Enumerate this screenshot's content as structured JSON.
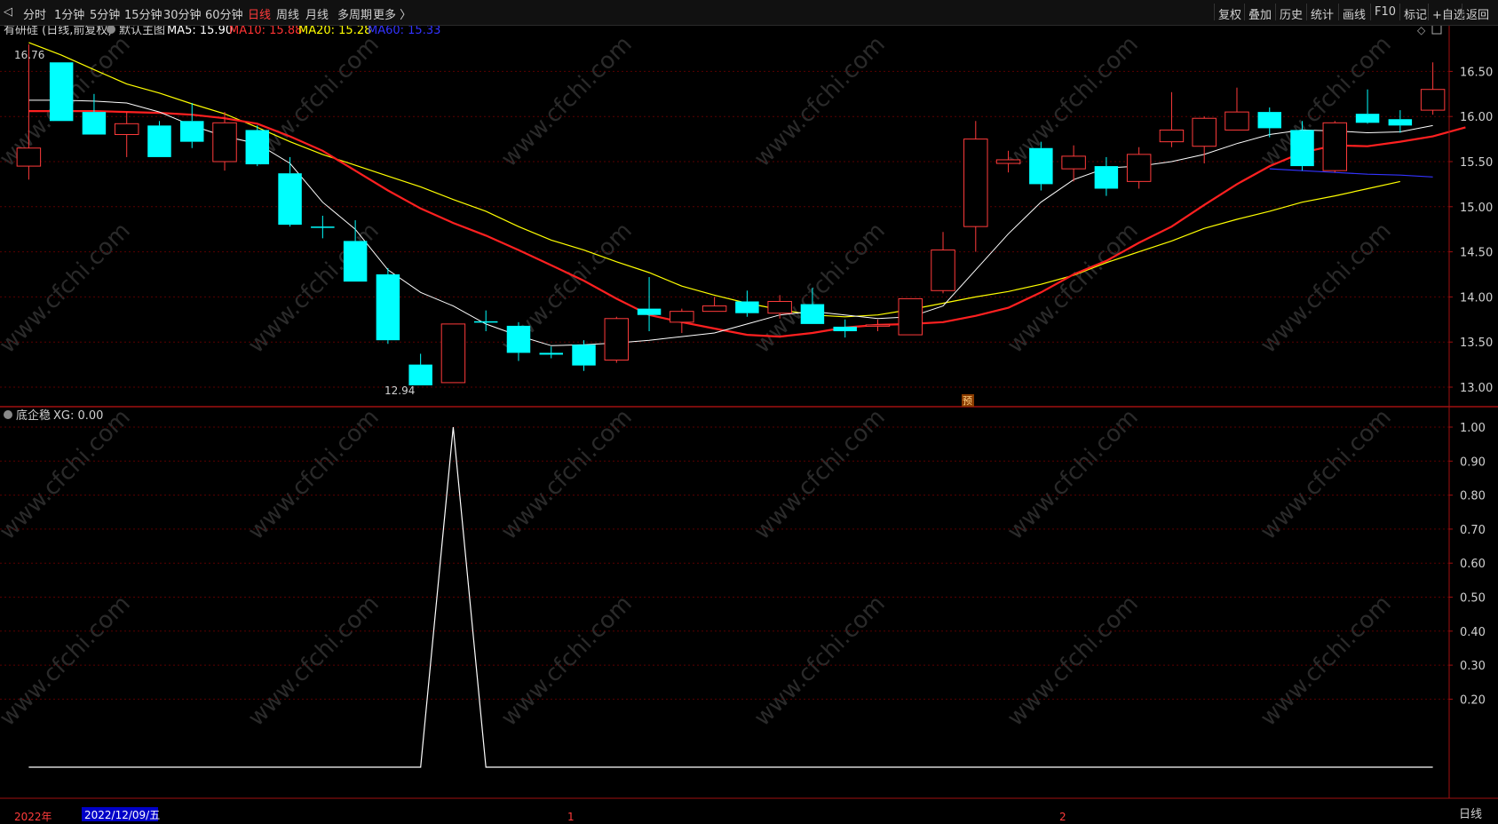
{
  "toolbar": {
    "left": [
      "分时",
      "1分钟",
      "5分钟",
      "15分钟",
      "30分钟",
      "60分钟",
      "日线",
      "周线",
      "月线",
      "多周期",
      "更多 〉"
    ],
    "active": "日线",
    "right": [
      "复权",
      "叠加",
      "历史",
      "统计",
      "画线",
      "F10",
      "标记",
      "+自选",
      "返回"
    ]
  },
  "main_legend": {
    "stock": "有研硅 (日线,前复权)",
    "template": "默认主图",
    "items": [
      {
        "label": "MA5: 15.90",
        "color": "#ffffff"
      },
      {
        "label": "MA10: 15.88",
        "color": "#ff3333"
      },
      {
        "label": "MA20: 15.28",
        "color": "#ffff00"
      },
      {
        "label": "MA60: 15.33",
        "color": "#3333ff"
      }
    ]
  },
  "sub_legend": {
    "name": "底企稳",
    "value": "XG: 0.00"
  },
  "annotations": {
    "high": "16.76",
    "low": "12.94",
    "forecast": "预"
  },
  "bottom": {
    "year": "2022年",
    "cursor_date": "2022/12/09/五",
    "month_labels": [
      "1",
      "2"
    ],
    "period": "日线"
  },
  "watermark": "www.cfchi.com",
  "colors": {
    "up": "#ff3b3b",
    "down": "#00ffff",
    "ma5": "#ffffff",
    "ma10": "#ff2020",
    "ma20": "#ffff00",
    "ma60": "#3333ff",
    "axis": "#a01010"
  },
  "chart_data": [
    {
      "type": "candlestick",
      "title": "有研硅 (日线,前复权)",
      "ylim": [
        12.8,
        16.8
      ],
      "y_ticks": [
        13.0,
        13.5,
        14.0,
        14.5,
        15.0,
        15.5,
        16.0,
        16.5
      ],
      "candles": [
        {
          "o": 15.45,
          "h": 16.8,
          "l": 15.3,
          "c": 15.65
        },
        {
          "o": 16.6,
          "h": 16.6,
          "l": 15.95,
          "c": 15.95
        },
        {
          "o": 16.05,
          "h": 16.25,
          "l": 15.8,
          "c": 15.8
        },
        {
          "o": 15.8,
          "h": 16.05,
          "l": 15.55,
          "c": 15.92
        },
        {
          "o": 15.9,
          "h": 15.95,
          "l": 15.55,
          "c": 15.55
        },
        {
          "o": 15.95,
          "h": 16.15,
          "l": 15.65,
          "c": 15.72
        },
        {
          "o": 15.5,
          "h": 16.05,
          "l": 15.4,
          "c": 15.93
        },
        {
          "o": 15.85,
          "h": 15.9,
          "l": 15.45,
          "c": 15.47
        },
        {
          "o": 15.37,
          "h": 15.55,
          "l": 14.78,
          "c": 14.8
        },
        {
          "o": 14.78,
          "h": 14.9,
          "l": 14.65,
          "c": 14.77
        },
        {
          "o": 14.62,
          "h": 14.85,
          "l": 14.17,
          "c": 14.17
        },
        {
          "o": 14.25,
          "h": 14.32,
          "l": 13.48,
          "c": 13.52
        },
        {
          "o": 13.25,
          "h": 13.37,
          "l": 13.02,
          "c": 13.02
        },
        {
          "o": 13.05,
          "h": 13.7,
          "l": 13.05,
          "c": 13.7
        },
        {
          "o": 13.73,
          "h": 13.85,
          "l": 13.62,
          "c": 13.72
        },
        {
          "o": 13.68,
          "h": 13.72,
          "l": 13.29,
          "c": 13.38
        },
        {
          "o": 13.38,
          "h": 13.45,
          "l": 13.32,
          "c": 13.36
        },
        {
          "o": 13.47,
          "h": 13.52,
          "l": 13.18,
          "c": 13.24
        },
        {
          "o": 13.3,
          "h": 13.78,
          "l": 13.27,
          "c": 13.76
        },
        {
          "o": 13.87,
          "h": 14.22,
          "l": 13.62,
          "c": 13.8
        },
        {
          "o": 13.72,
          "h": 13.87,
          "l": 13.6,
          "c": 13.84
        },
        {
          "o": 13.84,
          "h": 14.0,
          "l": 13.84,
          "c": 13.9
        },
        {
          "o": 13.95,
          "h": 14.07,
          "l": 13.78,
          "c": 13.82
        },
        {
          "o": 13.82,
          "h": 14.02,
          "l": 13.76,
          "c": 13.95
        },
        {
          "o": 13.92,
          "h": 14.1,
          "l": 13.7,
          "c": 13.7
        },
        {
          "o": 13.67,
          "h": 13.75,
          "l": 13.55,
          "c": 13.62
        },
        {
          "o": 13.69,
          "h": 13.75,
          "l": 13.62,
          "c": 13.69
        },
        {
          "o": 13.58,
          "h": 13.98,
          "l": 13.58,
          "c": 13.98
        },
        {
          "o": 14.07,
          "h": 14.72,
          "l": 14.04,
          "c": 14.52
        },
        {
          "o": 14.78,
          "h": 15.95,
          "l": 14.5,
          "c": 15.75
        },
        {
          "o": 15.48,
          "h": 15.62,
          "l": 15.38,
          "c": 15.52
        },
        {
          "o": 15.65,
          "h": 15.72,
          "l": 15.18,
          "c": 15.25
        },
        {
          "o": 15.42,
          "h": 15.68,
          "l": 15.28,
          "c": 15.56
        },
        {
          "o": 15.45,
          "h": 15.55,
          "l": 15.12,
          "c": 15.2
        },
        {
          "o": 15.28,
          "h": 15.66,
          "l": 15.2,
          "c": 15.58
        },
        {
          "o": 15.72,
          "h": 16.27,
          "l": 15.66,
          "c": 15.85
        },
        {
          "o": 15.67,
          "h": 16.0,
          "l": 15.48,
          "c": 15.98
        },
        {
          "o": 15.85,
          "h": 16.32,
          "l": 15.85,
          "c": 16.05
        },
        {
          "o": 16.05,
          "h": 16.1,
          "l": 15.77,
          "c": 15.87
        },
        {
          "o": 15.85,
          "h": 15.95,
          "l": 15.4,
          "c": 15.45
        },
        {
          "o": 15.4,
          "h": 15.95,
          "l": 15.38,
          "c": 15.93
        },
        {
          "o": 16.03,
          "h": 16.3,
          "l": 15.92,
          "c": 15.93
        },
        {
          "o": 15.97,
          "h": 16.07,
          "l": 15.82,
          "c": 15.9
        },
        {
          "o": 16.07,
          "h": 16.6,
          "l": 16.02,
          "c": 16.3
        }
      ],
      "ma5": [
        16.18,
        16.18,
        16.17,
        16.15,
        16.05,
        15.9,
        15.78,
        15.7,
        15.48,
        15.05,
        14.75,
        14.3,
        14.05,
        13.9,
        13.7,
        13.57,
        13.46,
        13.47,
        13.49,
        13.52,
        13.56,
        13.6,
        13.7,
        13.8,
        13.84,
        13.8,
        13.76,
        13.78,
        13.9,
        14.3,
        14.7,
        15.05,
        15.3,
        15.43,
        15.45,
        15.5,
        15.58,
        15.7,
        15.8,
        15.85,
        15.84,
        15.82,
        15.83,
        15.9
      ],
      "ma10": [
        16.06,
        16.06,
        16.06,
        16.05,
        16.04,
        16.02,
        15.98,
        15.92,
        15.78,
        15.62,
        15.4,
        15.18,
        14.98,
        14.82,
        14.68,
        14.52,
        14.35,
        14.18,
        13.98,
        13.8,
        13.72,
        13.65,
        13.58,
        13.56,
        13.6,
        13.66,
        13.69,
        13.7,
        13.72,
        13.79,
        13.88,
        14.05,
        14.25,
        14.4,
        14.6,
        14.78,
        15.02,
        15.25,
        15.45,
        15.6,
        15.68,
        15.67,
        15.72,
        15.78,
        15.88
      ],
      "ma20": [
        16.82,
        16.68,
        16.52,
        16.36,
        16.26,
        16.14,
        16.03,
        15.88,
        15.72,
        15.58,
        15.46,
        15.34,
        15.22,
        15.08,
        14.95,
        14.78,
        14.63,
        14.52,
        14.39,
        14.27,
        14.12,
        14.02,
        13.93,
        13.86,
        13.8,
        13.78,
        13.8,
        13.86,
        13.93,
        14.0,
        14.06,
        14.14,
        14.24,
        14.38,
        14.5,
        14.62,
        14.76,
        14.86,
        14.95,
        15.05,
        15.12,
        15.2,
        15.28
      ],
      "ma60": [
        15.42,
        15.4,
        15.38,
        15.36,
        15.35,
        15.33
      ],
      "xg": [
        0,
        0,
        0,
        0,
        0,
        0,
        0,
        0,
        0,
        0,
        0,
        0,
        0,
        1,
        0,
        0,
        0,
        0,
        0,
        0,
        0,
        0,
        0,
        0,
        0,
        0,
        0,
        0,
        0,
        0,
        0,
        0,
        0,
        0,
        0,
        0,
        0,
        0,
        0,
        0,
        0,
        0,
        0,
        0
      ],
      "xg_ylim": [
        0,
        1.0
      ],
      "xg_ticks": [
        0.2,
        0.3,
        0.4,
        0.5,
        0.6,
        0.7,
        0.8,
        0.9,
        1.0
      ]
    }
  ]
}
